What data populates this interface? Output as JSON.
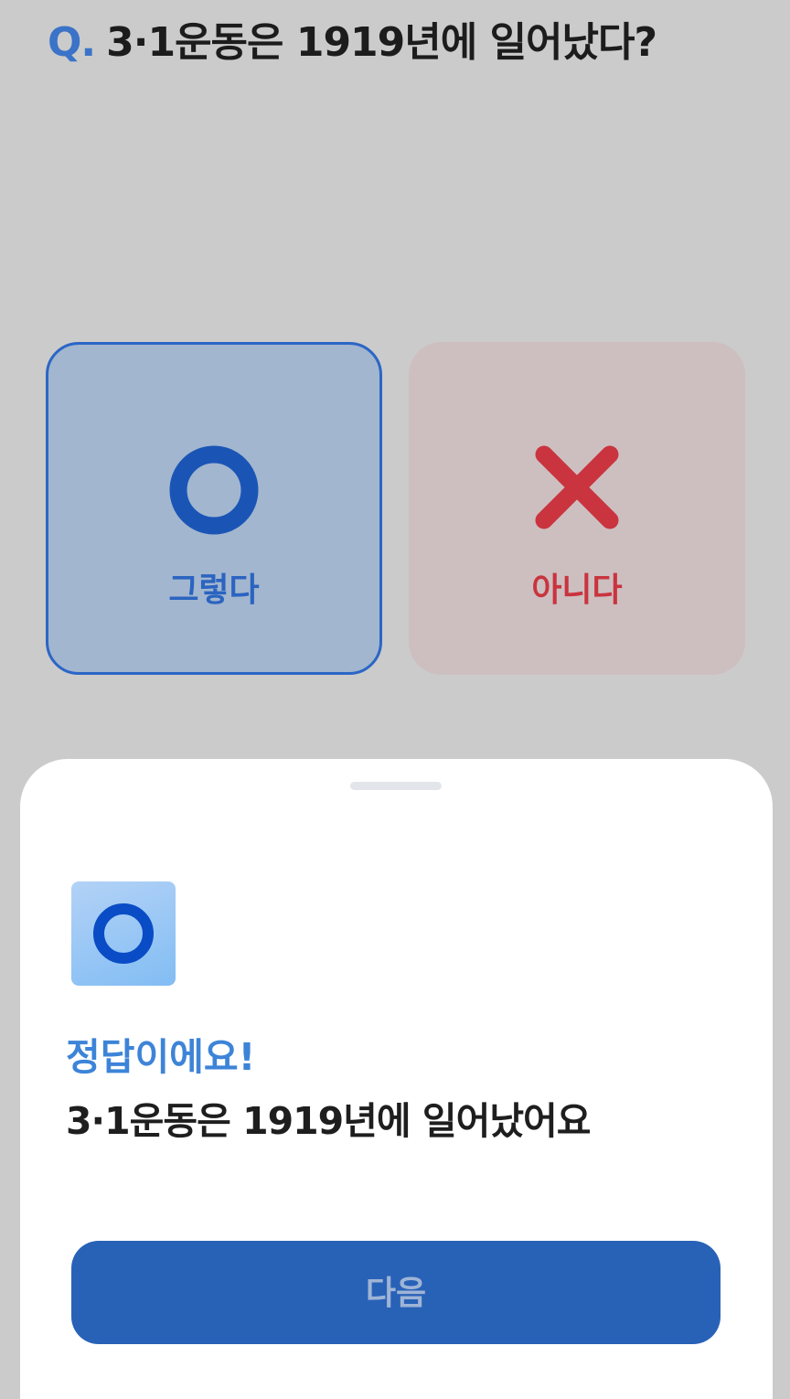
{
  "question": {
    "prefix": "Q.",
    "text": "3·1운동은 1919년에 일어났다?"
  },
  "choices": [
    {
      "id": "o",
      "icon": "circle-o-icon",
      "label": "그렇다",
      "color": "#2b64c0",
      "selected": true
    },
    {
      "id": "x",
      "icon": "cross-x-icon",
      "label": "아니다",
      "color": "#c9343f",
      "selected": false
    }
  ],
  "result": {
    "icon": "circle-o-icon",
    "title": "정답이에요!",
    "description": "3·1운동은 1919년에 일어났어요"
  },
  "next_button": {
    "label": "다음",
    "color": "#2862b7"
  }
}
